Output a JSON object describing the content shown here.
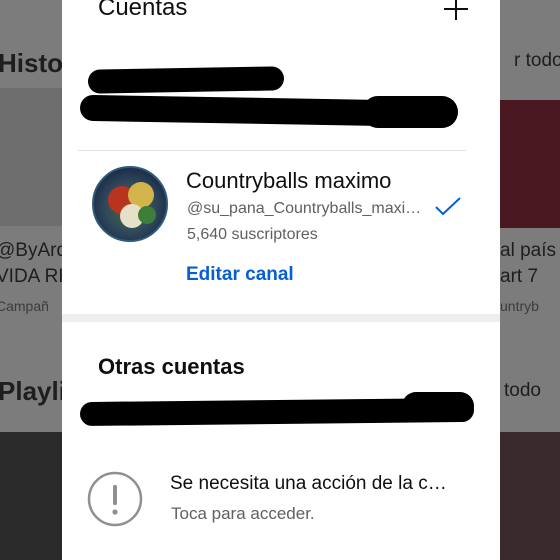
{
  "background": {
    "left": {
      "section1": "Histor",
      "channel_line1": "@ByArd",
      "channel_line2": "VIDA RI",
      "channel_meta": "Campañ",
      "section2": "Playlis"
    },
    "right": {
      "see_all_1": "r todo",
      "title_line1": "al país",
      "title_line2": "art 7",
      "meta": "untryb",
      "see_all_2": "todo"
    }
  },
  "dialog": {
    "title": "Cuentas",
    "add_icon": "plus-icon",
    "current_account": {
      "name": "Countryballs maximo",
      "handle": "@su_pana_Countryballs_maximo",
      "subscribers": "5,640 suscriptores",
      "edit_label": "Editar canal",
      "selected_icon": "checkmark-icon",
      "accent_color": "#065fd4"
    },
    "other_accounts": {
      "title": "Otras cuentas",
      "action_required": {
        "icon": "exclamation-circle-icon",
        "title": "Se necesita una acción de la cuenta",
        "subtitle": "Toca para acceder."
      }
    }
  }
}
